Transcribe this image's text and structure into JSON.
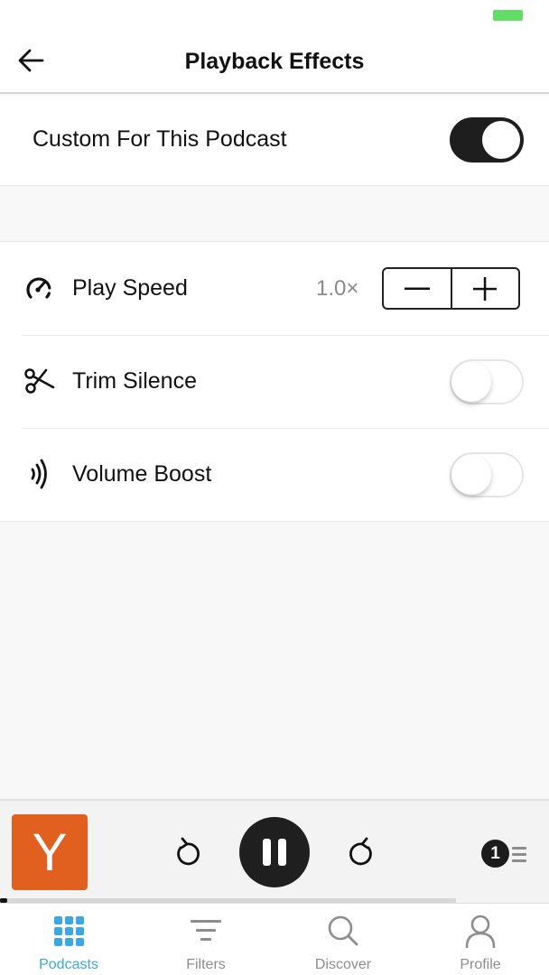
{
  "status_bar": {
    "battery_color": "#63dc68"
  },
  "nav": {
    "title": "Playback Effects",
    "back_icon": "arrow-left-icon"
  },
  "custom": {
    "label": "Custom For This Podcast",
    "enabled": true
  },
  "effects": {
    "play_speed": {
      "label": "Play Speed",
      "value": "1.0×",
      "icon": "speedometer-icon",
      "decrement_icon": "minus-icon",
      "increment_icon": "plus-icon"
    },
    "trim_silence": {
      "label": "Trim Silence",
      "enabled": false,
      "icon": "scissors-icon"
    },
    "volume_boost": {
      "label": "Volume Boost",
      "enabled": false,
      "icon": "volume-waves-icon"
    }
  },
  "player": {
    "artwork_letter": "Y",
    "artwork_color": "#e2601f",
    "state": "playing",
    "queue_count": "1",
    "progress_fraction": 0.01,
    "buffer_fraction": 0.83
  },
  "tabs": [
    {
      "label": "Podcasts",
      "icon": "grid-icon",
      "active": true
    },
    {
      "label": "Filters",
      "icon": "filter-icon",
      "active": false
    },
    {
      "label": "Discover",
      "icon": "search-icon",
      "active": false
    },
    {
      "label": "Profile",
      "icon": "person-icon",
      "active": false
    }
  ],
  "colors": {
    "accent": "#3ba8e4",
    "inactive": "#8d8d8d",
    "toggle_on": "#1e1e1e"
  }
}
